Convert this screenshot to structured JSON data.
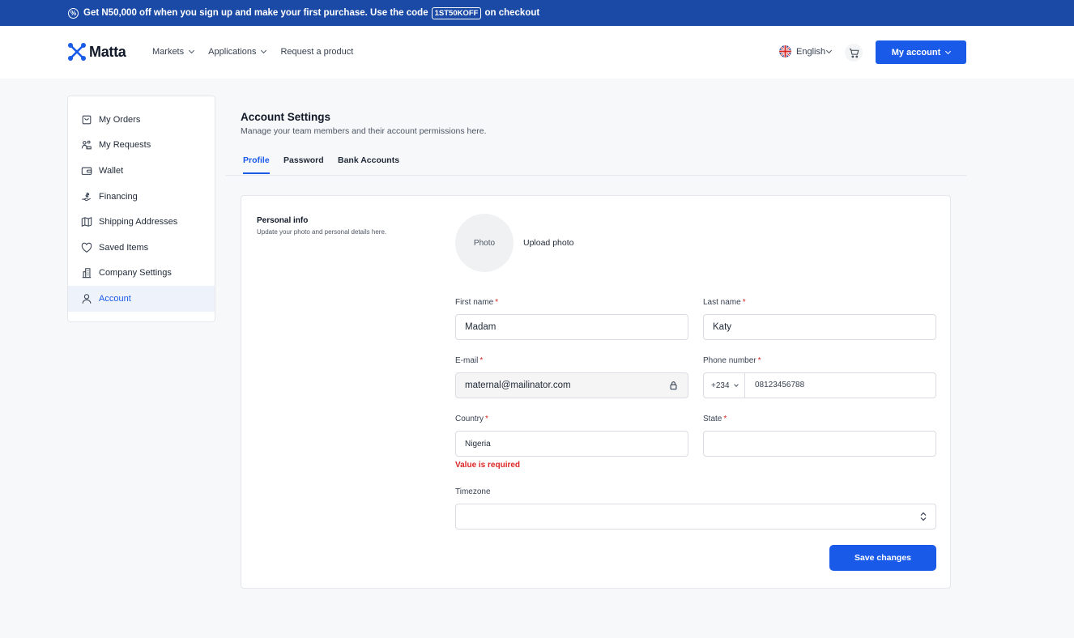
{
  "promo": {
    "text_before": "Get N50,000 off when you sign up and make your first purchase.   Use the code",
    "code": "1ST50KOFF",
    "text_after": "on checkout"
  },
  "header": {
    "brand": "Matta",
    "nav": [
      {
        "label": "Markets",
        "icon": "chevron-down-icon"
      },
      {
        "label": "Applications",
        "icon": "chevron-down-icon"
      },
      {
        "label": "Request a product"
      }
    ],
    "language": "English",
    "account_button": "My account"
  },
  "sidebar": {
    "items": [
      {
        "label": "My Orders",
        "icon": "shopping-bag-icon"
      },
      {
        "label": "My Requests",
        "icon": "requests-icon"
      },
      {
        "label": "Wallet",
        "icon": "wallet-icon"
      },
      {
        "label": "Financing",
        "icon": "financing-icon"
      },
      {
        "label": "Shipping Addresses",
        "icon": "map-icon"
      },
      {
        "label": "Saved Items",
        "icon": "heart-icon"
      },
      {
        "label": "Company Settings",
        "icon": "building-icon"
      },
      {
        "label": "Account",
        "icon": "user-icon",
        "active": true
      }
    ]
  },
  "main": {
    "title": "Account Settings",
    "subtitle": "Manage your team members and their account permissions here.",
    "tabs": [
      {
        "label": "Profile",
        "active": true
      },
      {
        "label": "Password"
      },
      {
        "label": "Bank Accounts"
      }
    ],
    "personal_info": {
      "title": "Personal info",
      "subtitle": "Update your photo and personal details here."
    },
    "photo_placeholder": "Photo",
    "upload_label": "Upload photo",
    "form": {
      "first_name": {
        "label": "First name",
        "value": "Madam"
      },
      "last_name": {
        "label": "Last name",
        "value": "Katy"
      },
      "email": {
        "label": "E-mail",
        "value": "maternal@mailinator.com"
      },
      "phone": {
        "label": "Phone number",
        "code": "+234",
        "value": "08123456788"
      },
      "country": {
        "label": "Country",
        "value": "Nigeria",
        "error": "Value is required"
      },
      "state": {
        "label": "State",
        "value": ""
      },
      "timezone": {
        "label": "Timezone",
        "value": ""
      },
      "required_mark": "*"
    },
    "save_button": "Save changes"
  },
  "colors": {
    "promo_bg": "#1b4aa6",
    "primary": "#1a5ae8",
    "error": "#dc2626"
  }
}
